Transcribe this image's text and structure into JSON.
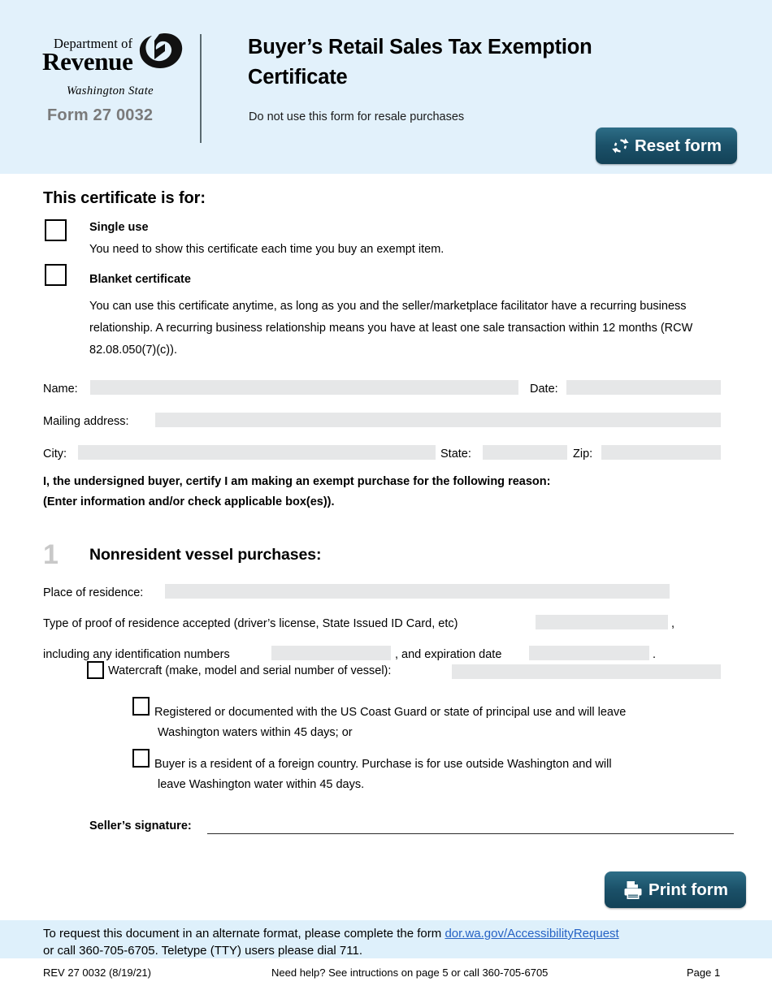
{
  "header": {
    "agency_line1": "Department of",
    "agency_line2": "Revenue",
    "agency_line3": "Washington State",
    "form_number": "Form 27 0032",
    "title": "Buyer’s Retail Sales Tax Exemption Certificate",
    "subtitle": "Do not use this form for resale purchases",
    "reset_button": "Reset form",
    "reset_icon": "refresh-circular-arrows-icon",
    "band_color": "#e2f1fb"
  },
  "certificate_for": {
    "heading": "This certificate is for:",
    "options": [
      {
        "label": "Single use",
        "description": "You need to show this certificate each time you buy an exempt item."
      },
      {
        "label": "Blanket certificate",
        "description": "You can use this certificate anytime, as long as you and the seller/marketplace facilitator have a recurring business relationship. A recurring business relationship means you have at least one sale transaction within 12 months (RCW 82.08.050(7)(c))."
      }
    ]
  },
  "buyer_fields": {
    "name_label": "Name:",
    "name_value": "",
    "date_label": "Date:",
    "date_value": "",
    "mailing_label": "Mailing address:",
    "mailing_value": "",
    "city_label": "City:",
    "city_value": "",
    "state_label": "State:",
    "state_value": "",
    "zip_label": "Zip:",
    "zip_value": ""
  },
  "certification": {
    "line1": "I, the undersigned buyer, certify I am making an exempt purchase for the following reason:",
    "line2": "(Enter information and/or check applicable box(es))."
  },
  "section1": {
    "number": "1",
    "title": "Nonresident vessel purchases:",
    "residence_label": "Place of residence:",
    "residence_value": "",
    "proof_label": "Type of proof of residence accepted (driver’s license, State Issued ID Card, etc)",
    "proof_value": "",
    "proof_comma": ",",
    "id_label": "including any identification numbers",
    "id_value": "",
    "exp_label": ", and expiration date",
    "exp_value": "",
    "exp_period": ".",
    "watercraft_label": "Watercraft (make, model and serial number of vessel):",
    "watercraft_value": "",
    "sub_options": [
      {
        "line1": "Registered or documented with the US Coast Guard or state of principal use and will leave",
        "line2": "Washington waters within 45 days; or"
      },
      {
        "line1": "Buyer is a resident of a foreign country. Purchase is for use outside Washington and will",
        "line2": "leave Washington water within 45 days."
      }
    ],
    "signature_label": "Seller’s signature:",
    "signature_value": ""
  },
  "print_button": {
    "label": "Print form",
    "icon": "printer-icon"
  },
  "footer": {
    "accessibility_pre": "To request this document in an alternate format, please complete the form ",
    "accessibility_link": "dor.wa.gov/AccessibilityRequest",
    "accessibility_post": "or call 360-705-6705. Teletype (TTY) users please dial 711.",
    "rev_line": "REV 27 0032  (8/19/21)",
    "help_line": "Need help? See intructions on page 5 or call 360-705-6705",
    "page_line": "Page 1",
    "band_color": "#def0fb",
    "link_color": "#2562c4"
  }
}
